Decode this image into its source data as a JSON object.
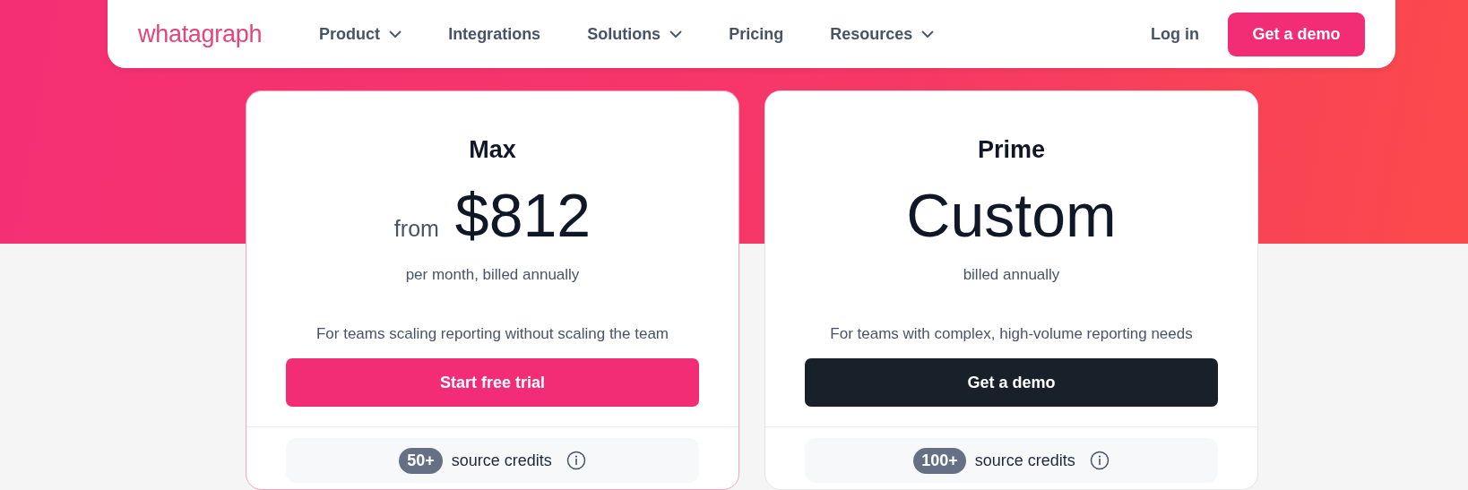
{
  "nav": {
    "logo": "whatagraph",
    "items": [
      {
        "label": "Product",
        "dropdown": true
      },
      {
        "label": "Integrations",
        "dropdown": false
      },
      {
        "label": "Solutions",
        "dropdown": true
      },
      {
        "label": "Pricing",
        "dropdown": false
      },
      {
        "label": "Resources",
        "dropdown": true
      }
    ],
    "login": "Log in",
    "cta": "Get a demo"
  },
  "plans": [
    {
      "name": "Max",
      "highlighted": true,
      "price_prefix": "from",
      "price": "$812",
      "billing": "per month, billed annually",
      "description": "For teams scaling reporting without scaling the team",
      "button": {
        "label": "Start free trial",
        "kind": "primary"
      },
      "credits_badge": "50+",
      "credits_label": "source credits"
    },
    {
      "name": "Prime",
      "highlighted": false,
      "price": "Custom",
      "billing": "billed annually",
      "description": "For teams with complex, high-volume reporting needs",
      "button": {
        "label": "Get a demo",
        "kind": "dark"
      },
      "credits_badge": "100+",
      "credits_label": "source credits"
    }
  ]
}
